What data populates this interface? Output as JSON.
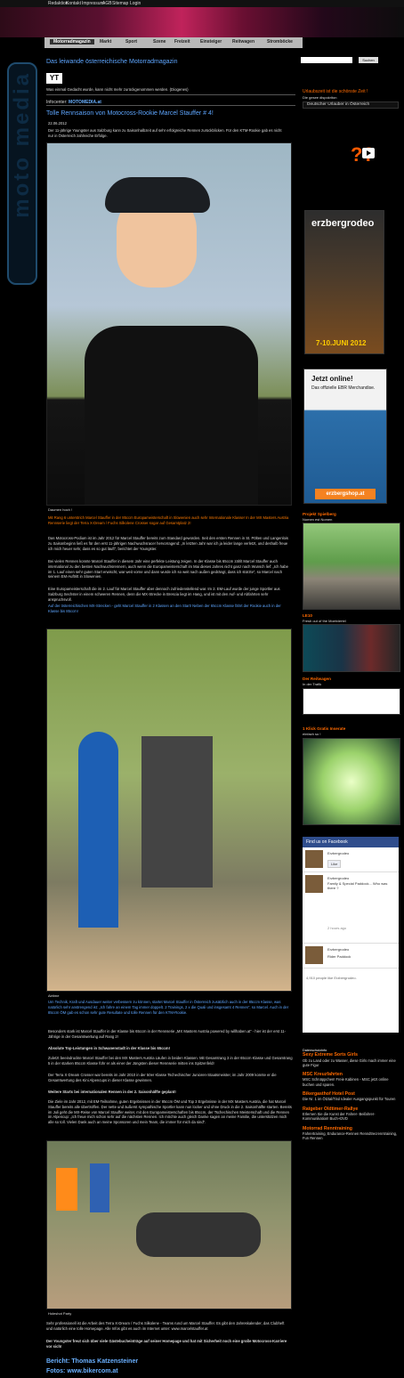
{
  "topbar": {
    "items": [
      "Redaktion",
      "Kontakt",
      "Impressum",
      "AGB",
      "Sitemap",
      "Login"
    ]
  },
  "nav": {
    "items": [
      "Motorradmagazin",
      "Markt",
      "Sport",
      "Szene",
      "Freizeit",
      "Einsteiger",
      "Reitwagen",
      "Stromböcke"
    ]
  },
  "header": {
    "title": "Das leiwande österreichische Motorradmagazin",
    "yt": "YT",
    "quote": "Was einmal Gedacht wurde, kann nicht mehr zurückgenommen werden. (Diogenes)",
    "info_label": "Infocenter",
    "info_value": "MOTOMEDIA.at"
  },
  "article": {
    "title": "Tolle Rennsaison von Motocross-Rookie Marcel Stauffer # 4!",
    "date": "22.06.2012",
    "intro": "Der 11-jährige Youngster aus Salzburg kann zu Saisonhalbzeit auf sehr erfolgreiche Rennen zurückblicken. Für den KTM-Rookie gab es nicht nur in Österreich zahlreiche Erfolge.",
    "caption1": "Daumen hoch !",
    "orange1": "Mit Rang 6 unterstrich Marcel Stauffer in der 85ccm Europameisterschaft in Slowenien auch sehr Internationale Klasse! In der MX Masters Austria Rennserie liegt der Terra X-Dream / Fuchs Silkolene Crosser sogar auf Gesamtplatz 2!",
    "p1": "Das Motocross-Podium ist im Jahr 2012 für Marcel Stauffer bereits zum Standard geworden. Seit den ersten Rennen in St. Pölten und Langenlois zu Saisonbeginn ließ es für den erst 11-jährigen Nachwuchsracer hervorragend: „In letzten Jahr war ich ja leider lange verletzt, und deshalb freue ich mich heuer sehr, dass es so gut läuft“, berichtet der Youngster.",
    "p2": "Bei vielen Rennen konnte Marcel Stauffer in diesem Jahr eine perfekte Leistung zeigen. In der Klasse bis 65ccm zählt Marcel Stauffer auch international zu den besten Nachwuchsrennern, auch wenn die Europameisterschaft im Mai dieses Jahres nicht ganz nach Wunsch lief: „Ich habe im 1. Lauf einen sehr guten Start erwischt, war weit vorne und dann wurde ich so weit nach außen gedrängt, dass ich stürzte“, so Marcel nach seinem EM-Auftritt in Slowenien.",
    "p3": "Eine Europameisterschaft die im 2. Lauf für Marcel Stauffer aber dennoch zufriedenstellend war. Im 2. EM-Lauf wurde der junge Sportler aus Salzburg Sechster in einem schweren Rennen, denn die MX-Strecke in Brescia liegt im Hang, und ist mit den Auf- und Abfahrten sehr anspruchsvoll.",
    "blue1": "Auf der österreichischen MX-Strecken - geht Marcel Stauffer in 2 Klassen an den Start! Neben der 65ccm Klasse fährt der Rookie auch in der Klasse bis 85ccm!",
    "caption2": "Airtime",
    "blue2": "Um Technik, Kraft und Ausdauer weiter verbessern zu können, startet Marcel Stauffer in Österreich zusätzlich auch in der 85ccm Klasse, was natürlich sehr anstrengend ist: „Ich fahre an einem Tag immer doppelt. 2 Trainings, 2 x die Quali und insgesamt 4 Rennen“, so Marcel. Auch in der 85ccm ÖM gab es schon sehr gute Resultate und tolle Rennen für den KTM-Rookie.",
    "p4": "Besonders stark ist Marcel Stauffer in der Klasse bis 65ccm in der Rennserie „MX Masters Austria powered by willhaben.at“ - hier ist der erst 11-Jährige in der Gesamtwertung auf Rang 2!",
    "h1": "Absolute Top-Leistungen in Schwanenstadt in der Klasse bis 65ccm!",
    "p5": "Zuletzt beeindruckte Marcel Stauffer bei den MX Masters Austria Läufen in beiden Klassen. Mit Gesamtrang 3 in der 65ccm Klasse und Gesamtrang 5 in der starken 85ccm Klasse führ er als einer der Jüngsten dieser Rennserie mitten ins Spitzenfeld!",
    "p6": "Der Terra X-Dream Crosser war bereits im Jahr 2010 in der 50er Klasse Tschechischer Junioren-Staatsmeister, im Jahr 2009 konnte er die Gesamtwertung des Kini Alpencups in dieser Klasse gewinnen.",
    "h2": "Weitere Starts bei internationalen Rennen in der 2. Saisonhälfte geplant!",
    "p7": "Die Ziele im Jahr 2012, mit EM-Teilnahme, guten Ergebnissen in der 85ccm ÖM und Top 3 Ergebnisse in der MX Masters Austria, die hat Marcel Stauffer bereits alle übertroffen. Der nette und äußerst sympathische Sportler kann nun locker und ohne Druck in die 2. Saisonhälfte starten. Bereits im Juli geht die MX-Reise von Marcel Stauffer weiter, mit den Europameisterschaften bis 85ccm, der Tschechischen Meisterschaft und die Rennen im Alpencup: „Ich freue mich schon sehr auf die nächsten Rennen. Ich möchte auch gleich Danke sagen an meine Familie, die unterstützen mich alle so toll. Vielen Dank auch an meine Sponsoren und mein Team, die immer für mich da sind“.",
    "caption3": "Holeshot Party",
    "p8": "Sehr professionell ist die Arbeit des Terra X-Dream / Fuchs Silkolene - Teams rund um Marcel Stauffer. Es gibt den Jahreskalender, das Clubheft und natürlich eine tolle Homepage. Alle Infos gibt es auch im Internet unter: www.marcelstauffer.at",
    "p9": "Der Youngster freut sich über viele Gästebucheinträge auf seiner Homepage und hat mit Sicherheit noch eine große Motocross-Karriere vor sich!",
    "bericht": "Bericht: Thomas Katzensteiner",
    "fotos": "Fotos: www.bikercom.at"
  },
  "right": {
    "search_button": "Suchen",
    "urlaub_title": "Urlaubszeit ist die schönste Zeit !",
    "urlaub_sub": "Die gesee dispokriton",
    "urlaub_select": "Deutscher Urlauber in Österreich",
    "erzberg_text": "erzbergrodeo",
    "erzberg_date": "7-10.JUNI 2012",
    "jetzt": "Jetzt online!",
    "offiziell": "Das offizielle EBR Merchandise.",
    "shop": "erzbergshop.at",
    "projekt_title": "Projekt Spielberg",
    "projekt_sub": "Nomen est Nomen",
    "le10_title": "LE10",
    "le10_sub": "Fresh out of the Moetviertel",
    "reitwagen_title": "Der Reitwagen",
    "reitwagen_sub": "In der Trafik",
    "klick_title": "1 Klick Gratis Inserate",
    "klick_sub": "einfach so !",
    "fb_title": "Find us on Facebook",
    "fb_name": "Erzbergrodeo",
    "fb_like": "Like",
    "fb_post": "Family & Special Paddock... Who was there ?",
    "fb_time": "2 hours ago",
    "fb_rider": "Rider Paddock",
    "fb_likes": "4,910 people like Erzbergrodeo.",
    "datenschutz": "Datenschutzinfo",
    "sexy_title": "Sexy Extreme Sorts Girls",
    "sexy_text": "Ob zu Land oder zu Wasser, diese Girls mach immer eine gute Figur",
    "msc_title": "MSC Kreuzfahrten",
    "msc_text": "MSC Schnäppchen! Freie Kabinen - MSC jetzt online buchen und sparen.",
    "bikers_title": "Bikergasthof Hotel Post",
    "bikers_text": "Die Nr. 1 im Ötztal/Tirol Idealer Ausgangspunkt für Touren",
    "ratgeber_title": "Ratgeber Oldtimer-Rallye",
    "ratgeber_text": "Erlernen Sie die Kunst der Fahrer- Beifahrer-Kommunikation! Buch+DVD",
    "renntraining_title": "Motorrad Renntraining",
    "renntraining_text": "Fahrertraining, Endurance-Rennen Renndtrecrenntraining, Fun Rennen"
  }
}
